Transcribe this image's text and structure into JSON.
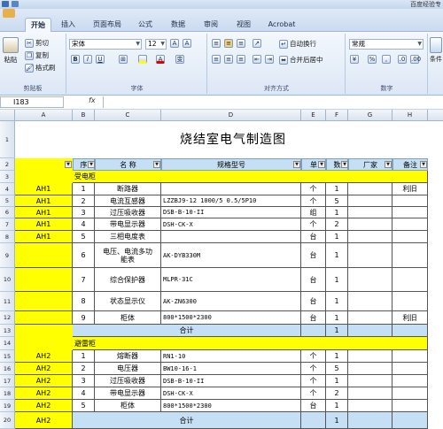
{
  "window": {
    "title": "百度经验专"
  },
  "tabs": [
    {
      "label": "开始"
    },
    {
      "label": "插入"
    },
    {
      "label": "页面布局"
    },
    {
      "label": "公式"
    },
    {
      "label": "数据"
    },
    {
      "label": "审阅"
    },
    {
      "label": "视图"
    },
    {
      "label": "Acrobat"
    }
  ],
  "ribbon": {
    "paste": "粘贴",
    "cut": "剪切",
    "copy": "复制",
    "format_painter": "格式刷",
    "font_name": "宋体",
    "font_size": "12",
    "bold": "B",
    "italic": "I",
    "underline": "U",
    "wrap_text": "自动换行",
    "merge_center": "合并后居中",
    "number_format": "常规",
    "percent": "%",
    "comma": ",",
    "groups": {
      "clipboard": "剪贴板",
      "font": "字体",
      "alignment": "对齐方式",
      "number": "数字"
    },
    "cond": "条件"
  },
  "formula_bar": {
    "name_box": "I183",
    "fx": "fx",
    "value": ""
  },
  "columns": [
    "A",
    "B",
    "C",
    "D",
    "E",
    "F",
    "G",
    "H"
  ],
  "row_numbers": [
    "1",
    "2",
    "3",
    "4",
    "5",
    "6",
    "7",
    "8",
    "9",
    "10",
    "11",
    "12",
    "13",
    "14",
    "15",
    "16",
    "17",
    "18",
    "19",
    "20"
  ],
  "sheet": {
    "title": "烧结室电气制造图",
    "headers": [
      "序",
      "名 称",
      "规格型号",
      "单",
      "数",
      "厂家",
      "备注"
    ],
    "section1": "受电柜",
    "section2": "避雷柜",
    "rows1": [
      {
        "a": "AH1",
        "no": "1",
        "name": "断路器",
        "spec": "",
        "unit": "个",
        "qty": "1",
        "note": "利旧"
      },
      {
        "a": "AH1",
        "no": "2",
        "name": "电流互感器",
        "spec": "LZZBJ9-12  1000/5  0.5/5P10",
        "unit": "个",
        "qty": "5",
        "note": ""
      },
      {
        "a": "AH1",
        "no": "3",
        "name": "过压吸收器",
        "spec": "DSB-B-10-II",
        "unit": "组",
        "qty": "1",
        "note": ""
      },
      {
        "a": "AH1",
        "no": "4",
        "name": "带电显示器",
        "spec": "DSH-CK-X",
        "unit": "个",
        "qty": "2",
        "note": ""
      },
      {
        "a": "AH1",
        "no": "5",
        "name": "三相电度表",
        "spec": "",
        "unit": "台",
        "qty": "1",
        "note": ""
      },
      {
        "a": "",
        "no": "6",
        "name": "电压、电流多功",
        "name2": "能表",
        "spec": "AK-DYB330M",
        "unit": "台",
        "qty": "1",
        "note": ""
      },
      {
        "a": "",
        "no": "7",
        "name": "综合保护器",
        "spec": "MLPR-31C",
        "unit": "台",
        "qty": "1",
        "note": ""
      },
      {
        "a": "",
        "no": "8",
        "name": "状态显示仪",
        "spec": "AK-ZN6300",
        "unit": "台",
        "qty": "1",
        "note": ""
      },
      {
        "a": "",
        "no": "9",
        "name": "柜体",
        "spec": "800*1500*2300",
        "unit": "台",
        "qty": "1",
        "note": "利旧"
      }
    ],
    "subtotal1": {
      "label": "合计",
      "qty": "1"
    },
    "rows2": [
      {
        "a": "AH2",
        "no": "1",
        "name": "熔断器",
        "spec": "RN1-10",
        "unit": "个",
        "qty": "1",
        "note": ""
      },
      {
        "a": "AH2",
        "no": "2",
        "name": "电压器",
        "spec": "BW10-16-1",
        "unit": "个",
        "qty": "5",
        "note": ""
      },
      {
        "a": "AH2",
        "no": "3",
        "name": "过压吸收器",
        "spec": "DSB-B-10-II",
        "unit": "个",
        "qty": "1",
        "note": ""
      },
      {
        "a": "AH2",
        "no": "4",
        "name": "带电显示器",
        "spec": "DSH-CK-X",
        "unit": "个",
        "qty": "2",
        "note": ""
      },
      {
        "a": "AH2",
        "no": "5",
        "name": "柜体",
        "spec": "800*1500*2300",
        "unit": "台",
        "qty": "1",
        "note": ""
      }
    ],
    "subtotal2": {
      "a": "AH2",
      "label": "合计",
      "qty": "1"
    }
  }
}
